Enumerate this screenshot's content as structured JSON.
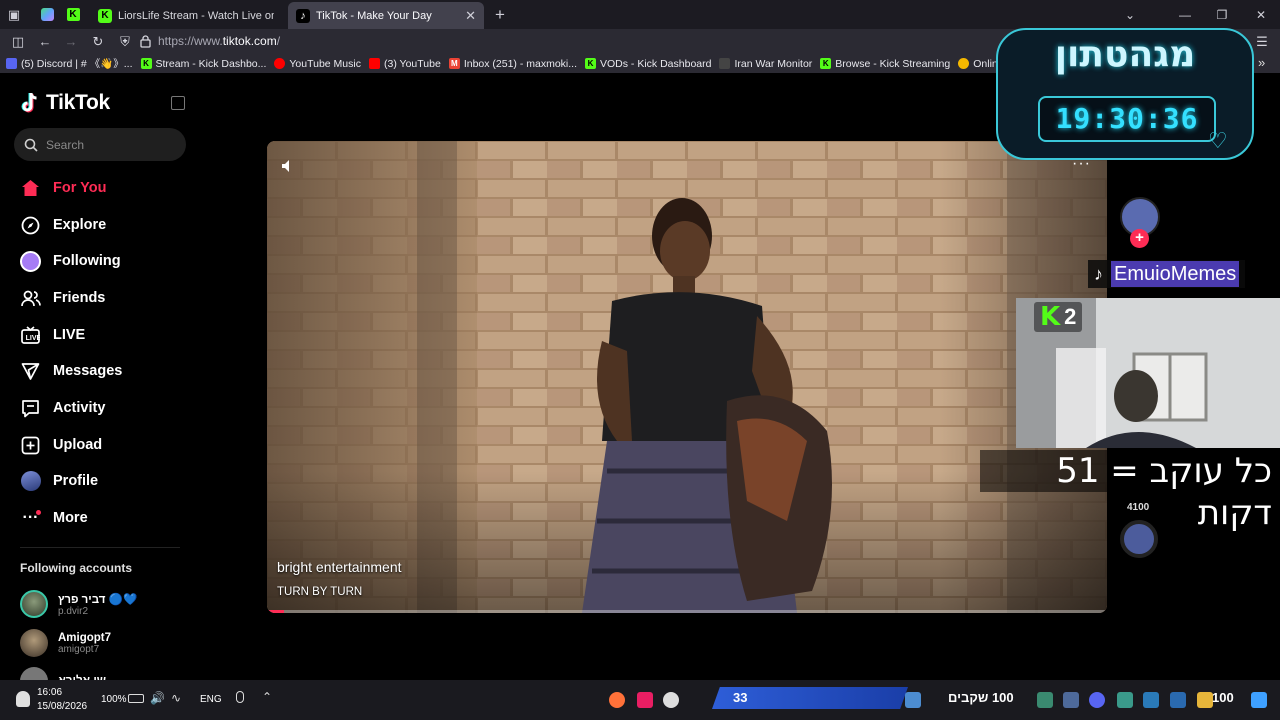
{
  "browser": {
    "tabs": [
      {
        "title": "LiorsLife Stream - Watch Live on",
        "active": false,
        "fav_color": "#53fc18"
      },
      {
        "title": "TikTok - Make Your Day",
        "active": true,
        "fav_color": "#ffffff"
      }
    ],
    "url_prefix": "https://www.",
    "url_domain": "tiktok.com",
    "url_suffix": "/",
    "bookmarks": [
      {
        "label": "(5) Discord | # 《👋》...",
        "color": "#5865f2"
      },
      {
        "label": "Stream - Kick Dashbo...",
        "color": "#53fc18"
      },
      {
        "label": "YouTube Music",
        "color": "#ff0000"
      },
      {
        "label": "(3) YouTube",
        "color": "#ff0000"
      },
      {
        "label": "Inbox (251) - maxmoki...",
        "color": "#ea4335"
      },
      {
        "label": "VODs - Kick Dashboard",
        "color": "#53fc18"
      },
      {
        "label": "Iran War Monitor",
        "color": "#cccccc"
      },
      {
        "label": "Browse - Kick Streaming",
        "color": "#53fc18"
      },
      {
        "label": "Online Em",
        "color": "#f5b800"
      }
    ]
  },
  "tiktok": {
    "logo": "TikTok",
    "search_placeholder": "Search",
    "nav": [
      {
        "label": "For You",
        "icon": "home-icon",
        "active": true
      },
      {
        "label": "Explore",
        "icon": "compass-icon",
        "active": false
      },
      {
        "label": "Following",
        "icon": "following-avatar-icon",
        "active": false
      },
      {
        "label": "Friends",
        "icon": "friends-icon",
        "active": false
      },
      {
        "label": "LIVE",
        "icon": "live-icon",
        "active": false
      },
      {
        "label": "Messages",
        "icon": "messages-icon",
        "active": false
      },
      {
        "label": "Activity",
        "icon": "activity-icon",
        "active": false
      },
      {
        "label": "Upload",
        "icon": "upload-icon",
        "active": false
      },
      {
        "label": "Profile",
        "icon": "profile-icon",
        "active": false
      },
      {
        "label": "More",
        "icon": "more-icon",
        "active": false
      }
    ],
    "following_title": "Following accounts",
    "following": [
      {
        "name": "דביר פרץ 🔵💙",
        "handle": "p.dvir2"
      },
      {
        "name": "Amigopt7",
        "handle": "amigopt7"
      },
      {
        "name": "שי אלירא",
        "handle": ""
      }
    ],
    "video": {
      "author": "bright entertainment",
      "music": "TURN BY TURN",
      "progress": 0.02
    },
    "like_count": "4100"
  },
  "overlay": {
    "countdown_title": "מגהטתון",
    "countdown_time": "19:30:36",
    "tiktok_handle": "EmuioMemes",
    "kick_badge": "2",
    "banner": "כל עוקב = 51 דקות"
  },
  "taskbar": {
    "time": "16:06",
    "date": "15/08/2026",
    "battery": "100%",
    "lang": "ENG",
    "goal_count": "33",
    "subs_label": "100 שקבים",
    "right_count": "100"
  }
}
